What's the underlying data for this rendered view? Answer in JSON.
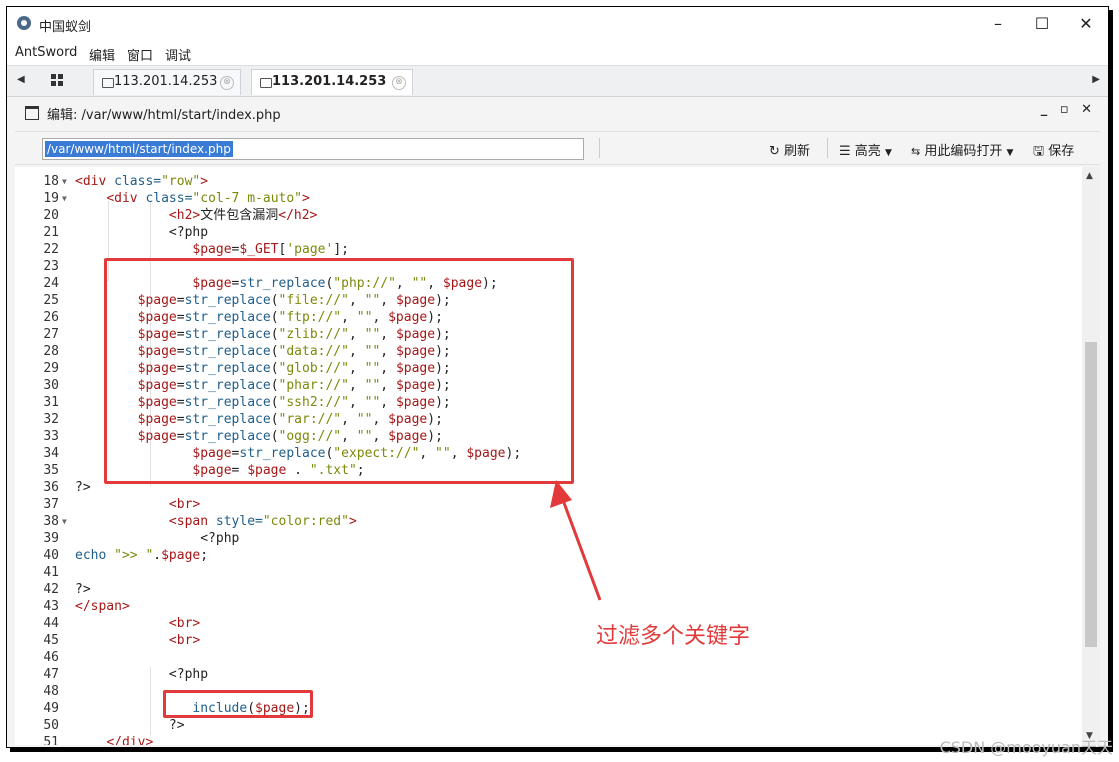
{
  "window": {
    "title": "中国蚁剑",
    "minimize": "–",
    "maximize": "☐",
    "close": "✕"
  },
  "menu": [
    "AntSword",
    "编辑",
    "窗口",
    "调试"
  ],
  "tabs": [
    {
      "label": "113.201.14.253",
      "close": "⊗"
    },
    {
      "label": "113.201.14.253",
      "close": "⊗"
    }
  ],
  "panel": {
    "title": "编辑: /var/www/html/start/index.php",
    "controls": "_ ▫ ✕"
  },
  "toolbar": {
    "path": "/var/www/html/start/index.php",
    "refresh": "刷新",
    "highlight": "高亮",
    "open_with_encoding": "用此编码打开",
    "save": "保存"
  },
  "code_lines": [
    {
      "n": "18",
      "fold": true,
      "html": "<span class=\"tg\">&lt;div</span> <span class=\"at\">class=</span><span class=\"st\">\"row\"</span><span class=\"tg\">&gt;</span>"
    },
    {
      "n": "19",
      "fold": true,
      "html": "    <span class=\"tg\">&lt;div</span> <span class=\"at\">class=</span><span class=\"st\">\"col-7 m-auto\"</span><span class=\"tg\">&gt;</span>"
    },
    {
      "n": "20",
      "fold": false,
      "html": "            <span class=\"tg\">&lt;h2&gt;</span>文件包含漏洞<span class=\"tg\">&lt;/h2&gt;</span>"
    },
    {
      "n": "21",
      "fold": false,
      "html": "            &lt;?php"
    },
    {
      "n": "22",
      "fold": false,
      "html": "               <span class=\"vr\">$page</span>=<span class=\"vr\">$_GET</span>[<span class=\"st\">'page'</span>];"
    },
    {
      "n": "23",
      "fold": false,
      "html": ""
    },
    {
      "n": "24",
      "fold": false,
      "html": "               <span class=\"vr\">$page</span>=<span class=\"fn\">str_replace</span>(<span class=\"st\">\"php://\"</span>, <span class=\"st\">\"\"</span>, <span class=\"vr\">$page</span>);"
    },
    {
      "n": "25",
      "fold": false,
      "html": "        <span class=\"vr\">$page</span>=<span class=\"fn\">str_replace</span>(<span class=\"st\">\"file://\"</span>, <span class=\"st\">\"\"</span>, <span class=\"vr\">$page</span>);"
    },
    {
      "n": "26",
      "fold": false,
      "html": "        <span class=\"vr\">$page</span>=<span class=\"fn\">str_replace</span>(<span class=\"st\">\"ftp://\"</span>, <span class=\"st\">\"\"</span>, <span class=\"vr\">$page</span>);"
    },
    {
      "n": "27",
      "fold": false,
      "html": "        <span class=\"vr\">$page</span>=<span class=\"fn\">str_replace</span>(<span class=\"st\">\"zlib://\"</span>, <span class=\"st\">\"\"</span>, <span class=\"vr\">$page</span>);"
    },
    {
      "n": "28",
      "fold": false,
      "html": "        <span class=\"vr\">$page</span>=<span class=\"fn\">str_replace</span>(<span class=\"st\">\"data://\"</span>, <span class=\"st\">\"\"</span>, <span class=\"vr\">$page</span>);"
    },
    {
      "n": "29",
      "fold": false,
      "html": "        <span class=\"vr\">$page</span>=<span class=\"fn\">str_replace</span>(<span class=\"st\">\"glob://\"</span>, <span class=\"st\">\"\"</span>, <span class=\"vr\">$page</span>);"
    },
    {
      "n": "30",
      "fold": false,
      "html": "        <span class=\"vr\">$page</span>=<span class=\"fn\">str_replace</span>(<span class=\"st\">\"phar://\"</span>, <span class=\"st\">\"\"</span>, <span class=\"vr\">$page</span>);"
    },
    {
      "n": "31",
      "fold": false,
      "html": "        <span class=\"vr\">$page</span>=<span class=\"fn\">str_replace</span>(<span class=\"st\">\"ssh2://\"</span>, <span class=\"st\">\"\"</span>, <span class=\"vr\">$page</span>);"
    },
    {
      "n": "32",
      "fold": false,
      "html": "        <span class=\"vr\">$page</span>=<span class=\"fn\">str_replace</span>(<span class=\"st\">\"rar://\"</span>, <span class=\"st\">\"\"</span>, <span class=\"vr\">$page</span>);"
    },
    {
      "n": "33",
      "fold": false,
      "html": "        <span class=\"vr\">$page</span>=<span class=\"fn\">str_replace</span>(<span class=\"st\">\"ogg://\"</span>, <span class=\"st\">\"\"</span>, <span class=\"vr\">$page</span>);"
    },
    {
      "n": "34",
      "fold": false,
      "html": "               <span class=\"vr\">$page</span>=<span class=\"fn\">str_replace</span>(<span class=\"st\">\"expect://\"</span>, <span class=\"st\">\"\"</span>, <span class=\"vr\">$page</span>);"
    },
    {
      "n": "35",
      "fold": false,
      "html": "               <span class=\"vr\">$page</span>= <span class=\"vr\">$page</span> . <span class=\"st\">\".txt\"</span>;"
    },
    {
      "n": "36",
      "fold": false,
      "html": "?&gt;"
    },
    {
      "n": "37",
      "fold": false,
      "html": "            <span class=\"tg\">&lt;br&gt;</span>"
    },
    {
      "n": "38",
      "fold": true,
      "html": "            <span class=\"tg\">&lt;span</span> <span class=\"at\">style=</span><span class=\"st\">\"color:red\"</span><span class=\"tg\">&gt;</span>"
    },
    {
      "n": "39",
      "fold": false,
      "html": "                &lt;?php"
    },
    {
      "n": "40",
      "fold": false,
      "html": "<span class=\"fn\">echo</span> <span class=\"st\">\"&gt;&gt; \"</span>.<span class=\"vr\">$page</span>;"
    },
    {
      "n": "41",
      "fold": false,
      "html": ""
    },
    {
      "n": "42",
      "fold": false,
      "html": "?&gt;"
    },
    {
      "n": "43",
      "fold": false,
      "html": "<span class=\"tg\">&lt;/span&gt;</span>"
    },
    {
      "n": "44",
      "fold": false,
      "html": "            <span class=\"tg\">&lt;br&gt;</span>"
    },
    {
      "n": "45",
      "fold": false,
      "html": "            <span class=\"tg\">&lt;br&gt;</span>"
    },
    {
      "n": "46",
      "fold": false,
      "html": ""
    },
    {
      "n": "47",
      "fold": false,
      "html": "            &lt;?php"
    },
    {
      "n": "48",
      "fold": false,
      "html": ""
    },
    {
      "n": "49",
      "fold": false,
      "html": "               <span class=\"fn\">include</span>(<span class=\"vr\">$page</span>);"
    },
    {
      "n": "50",
      "fold": false,
      "html": "            ?&gt;"
    },
    {
      "n": "51",
      "fold": false,
      "html": "    <span class=\"tg\">&lt;/div&gt;</span>"
    }
  ],
  "annotation": "过滤多个关键字",
  "watermark": "CSDN @mooyuan天天",
  "colors": {
    "annotation": "#e23a3a",
    "selection": "#3a7bd5"
  }
}
